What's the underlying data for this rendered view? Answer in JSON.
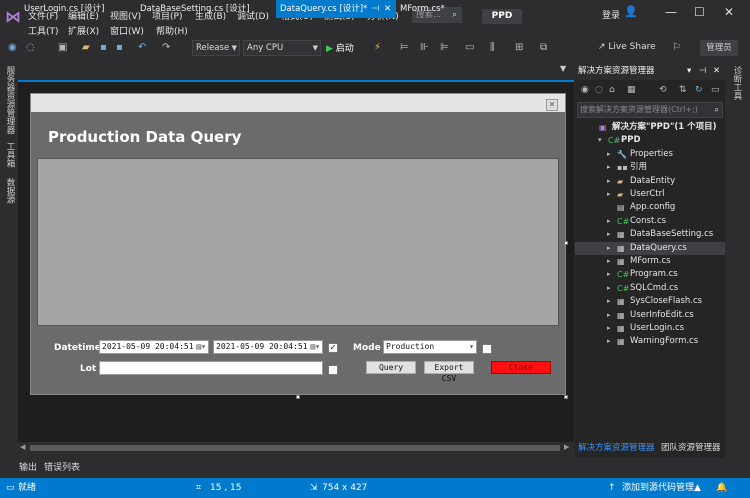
{
  "menu": {
    "row1": [
      "文件(F)",
      "编辑(E)",
      "视图(V)",
      "项目(P)",
      "生成(B)",
      "调试(D)",
      "格式(O)",
      "测试(S)",
      "分析(N)"
    ],
    "row2": [
      "工具(T)",
      "扩展(X)",
      "窗口(W)",
      "帮助(H)"
    ],
    "search_placeholder": "搜索...",
    "solution_badge": "PPD",
    "login": "登录"
  },
  "toolbar": {
    "config": "Release",
    "platform": "Any CPU",
    "start_label": "启动",
    "live_share": "Live Share",
    "admin_label": "管理员"
  },
  "left_strip": [
    "服务器资源管理器",
    "工具箱",
    "数据源"
  ],
  "tabs": [
    {
      "label": "UserLogin.cs [设计]"
    },
    {
      "label": "DataBaseSetting.cs [设计]"
    },
    {
      "label": "DataQuery.cs [设计]*"
    },
    {
      "label": "MForm.cs*"
    }
  ],
  "form": {
    "title": "Production Data Query",
    "datetime_label": "Datetime",
    "lot_label": "Lot",
    "mode_label": "Mode",
    "dt_from": "2021-05-09 20:04:51",
    "dt_to": "2021-05-09 20:04:51",
    "mode_value": "Production",
    "lot_value": "",
    "query_label": "Query",
    "export_label": "Export CSV",
    "close_label": "Close",
    "close_color": "#ff1010"
  },
  "output_tabs": [
    "输出",
    "错误列表"
  ],
  "solution_explorer": {
    "title": "解决方案资源管理器",
    "search_placeholder": "搜索解决方案资源管理器(Ctrl+;)",
    "items": [
      {
        "label": "解决方案\"PPD\"(1 个项目)",
        "icon": "solution-icon"
      },
      {
        "label": "PPD",
        "icon": "csharp-project-icon"
      },
      {
        "label": "Properties",
        "icon": "wrench-icon"
      },
      {
        "label": "引用",
        "icon": "references-icon"
      },
      {
        "label": "DataEntity",
        "icon": "folder-icon"
      },
      {
        "label": "UserCtrl",
        "icon": "folder-icon"
      },
      {
        "label": "App.config",
        "icon": "config-icon"
      },
      {
        "label": "Const.cs",
        "icon": "csharp-file-icon"
      },
      {
        "label": "DataBaseSetting.cs",
        "icon": "form-icon"
      },
      {
        "label": "DataQuery.cs",
        "icon": "form-icon"
      },
      {
        "label": "MForm.cs",
        "icon": "form-icon"
      },
      {
        "label": "Program.cs",
        "icon": "csharp-file-icon"
      },
      {
        "label": "SQLCmd.cs",
        "icon": "csharp-file-icon"
      },
      {
        "label": "SysCloseFlash.cs",
        "icon": "form-icon"
      },
      {
        "label": "UserInfoEdit.cs",
        "icon": "form-icon"
      },
      {
        "label": "UserLogin.cs",
        "icon": "form-icon"
      },
      {
        "label": "WarningForm.cs",
        "icon": "form-icon"
      }
    ],
    "footer_tabs": [
      "解决方案资源管理器",
      "团队资源管理器"
    ]
  },
  "right_strip": "诊断工具",
  "status": {
    "ready": "就绪",
    "position": "15 , 15",
    "size": "754 x 427",
    "source_control": "添加到源代码管理"
  },
  "colors": {
    "accent": "#007acc",
    "ide_bg": "#2d2d30"
  }
}
